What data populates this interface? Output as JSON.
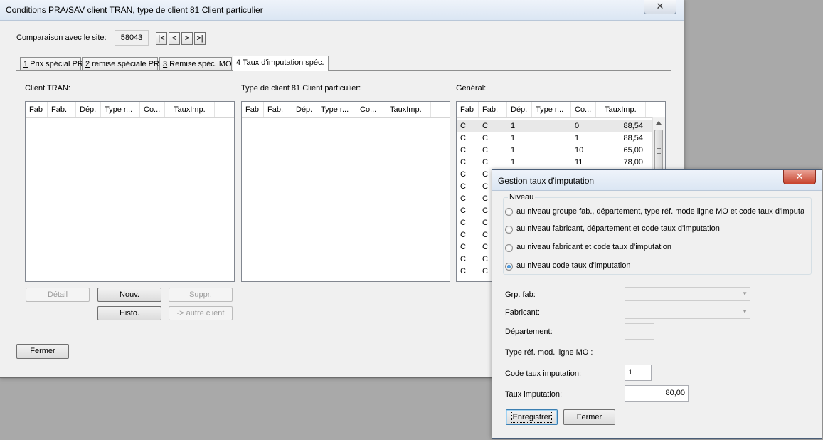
{
  "main_window": {
    "title": "Conditions PRA/SAV client TRAN, type de client 81 Client particulier",
    "compare_label": "Comparaison avec le site:",
    "site_value": "58043",
    "nav": {
      "first": "|<",
      "prev": "<",
      "next": ">",
      "last": ">|"
    },
    "tabs": [
      {
        "num": "1",
        "label": " Prix spécial PR"
      },
      {
        "num": "2",
        "label": " remise spéciale PR"
      },
      {
        "num": "3",
        "label": " Remise spéc. MO"
      },
      {
        "num": "4",
        "label": " Taux d'imputation spéc."
      }
    ],
    "sections": {
      "client": "Client TRAN:",
      "type_client": "Type de client 81 Client particulier:",
      "general": "Général:"
    },
    "columns": [
      "Fab",
      "Fab.",
      "Dép.",
      "Type r...",
      "Co...",
      "TauxImp."
    ],
    "general_rows": [
      [
        "C",
        "C",
        "1",
        "",
        "0",
        "88,54"
      ],
      [
        "C",
        "C",
        "1",
        "",
        "1",
        "88,54"
      ],
      [
        "C",
        "C",
        "1",
        "",
        "10",
        "65,00"
      ],
      [
        "C",
        "C",
        "1",
        "",
        "11",
        "78,00"
      ],
      [
        "C",
        "C"
      ],
      [
        "C",
        "C"
      ],
      [
        "C",
        "C"
      ],
      [
        "C",
        "C"
      ],
      [
        "C",
        "C"
      ],
      [
        "C",
        "C"
      ],
      [
        "C",
        "C"
      ],
      [
        "C",
        "C"
      ],
      [
        "C",
        "C"
      ]
    ],
    "buttons": {
      "detail": "Détail",
      "new": "Nouv.",
      "delete": "Suppr.",
      "history": "Histo.",
      "other_client": "-> autre client",
      "close": "Fermer"
    },
    "close_glyph": "✕"
  },
  "dialog": {
    "title": "Gestion taux d'imputation",
    "close_glyph": "✕",
    "group_title": "Niveau",
    "options": [
      {
        "label": "au niveau groupe fab., département, type réf. mode ligne MO et code taux d'imputa",
        "checked": false
      },
      {
        "label": "au niveau fabricant, département et code taux d'imputation",
        "checked": false
      },
      {
        "label": "au niveau fabricant et code taux d'imputation",
        "checked": false
      },
      {
        "label": "au niveau code taux d'imputation",
        "checked": true
      }
    ],
    "fields": {
      "grp_fab_label": "Grp. fab:",
      "fabricant_label": "Fabricant:",
      "departement_label": "Département:",
      "type_ref_label": "Type réf. mod. ligne MO :",
      "code_label": "Code taux imputation:",
      "code_value": "1",
      "taux_label": "Taux imputation:",
      "taux_value": "80,00"
    },
    "buttons": {
      "save": "Enregistrer",
      "close": "Fermer"
    }
  },
  "colors": {
    "window_bg": "#f0f0f0",
    "desktop_bg": "#a9a9a9",
    "close_red": "#c7432d"
  }
}
